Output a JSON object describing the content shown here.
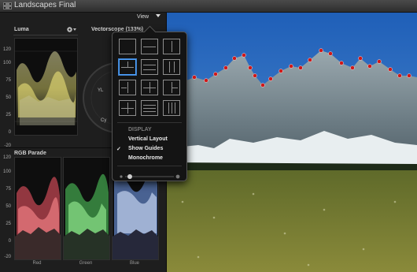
{
  "window": {
    "title": "Landscapes Final"
  },
  "luma": {
    "title": "Luma",
    "y_ticks": [
      "120",
      "100",
      "75",
      "50",
      "25",
      "0",
      "-20"
    ]
  },
  "vectorscope": {
    "title": "Vectorscope (133%)",
    "labels": [
      "YL",
      "Cy"
    ]
  },
  "parade": {
    "title": "RGB Parade",
    "y_ticks": [
      "120",
      "100",
      "75",
      "50",
      "25",
      "0",
      "-20"
    ],
    "channels": [
      "Red",
      "Green",
      "Blue"
    ]
  },
  "view_menu": {
    "label": "View",
    "section": "DISPLAY",
    "items": [
      {
        "label": "Vertical Layout",
        "checked": false
      },
      {
        "label": "Show Guides",
        "checked": true
      },
      {
        "label": "Monochrome",
        "checked": false
      }
    ],
    "check": "✓",
    "selected_layout_index": 3
  },
  "colors": {
    "accent": "#4ea1ff",
    "guide": "#d01818"
  }
}
